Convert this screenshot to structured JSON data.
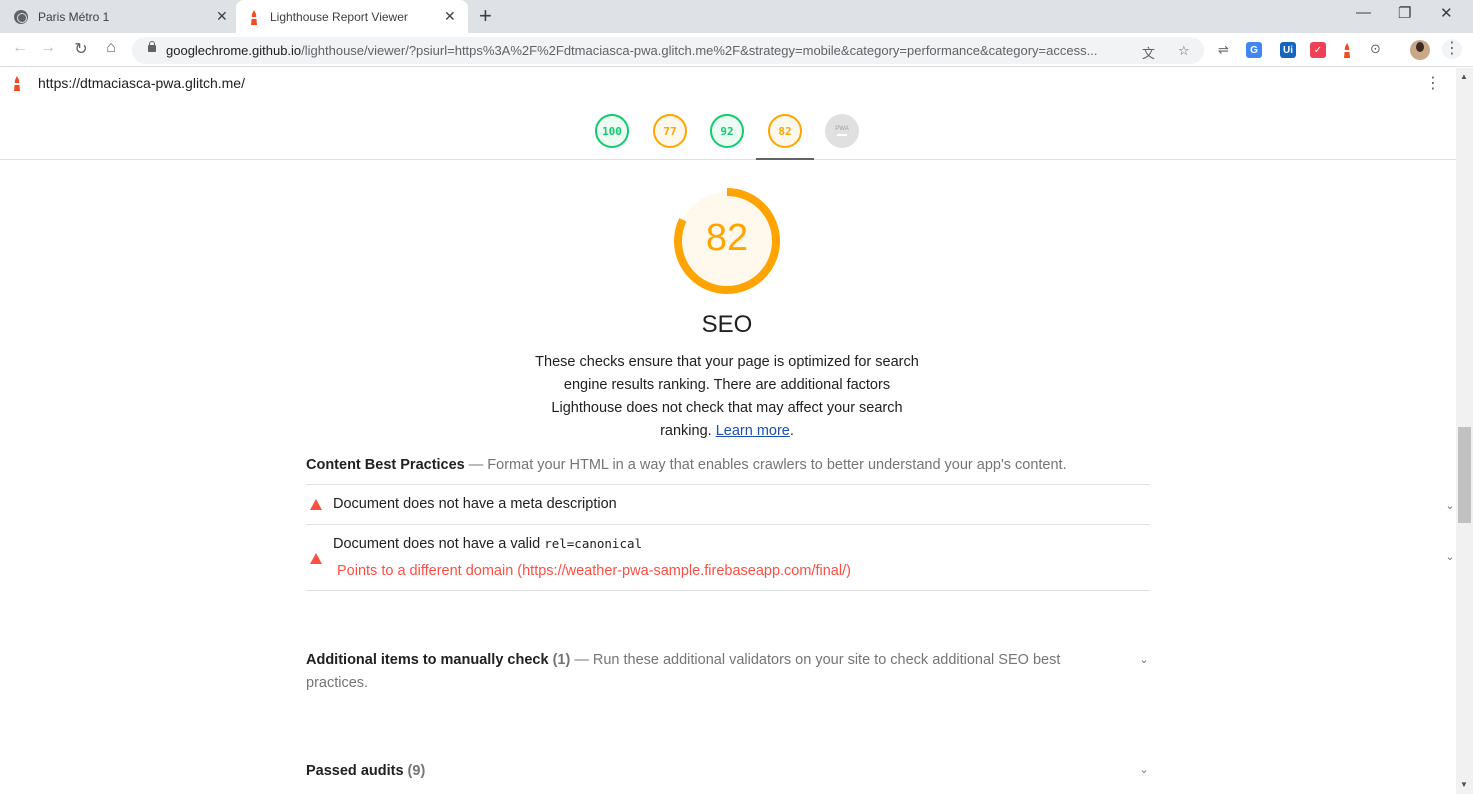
{
  "browser": {
    "tabs": [
      {
        "title": "Paris Métro 1",
        "active": false
      },
      {
        "title": "Lighthouse Report Viewer",
        "active": true
      }
    ],
    "new_tab": "+",
    "window_controls": {
      "minimize": "—",
      "restore": "❐",
      "close": "✕"
    },
    "url_host": "googlechrome.github.io",
    "url_rest": "/lighthouse/viewer/?psiurl=https%3A%2F%2Fdtmaciasca-pwa.glitch.me%2F&strategy=mobile&category=performance&category=access...",
    "extensions": [
      {
        "name": "translate-icon",
        "label": "G",
        "color": "#4285f4"
      },
      {
        "name": "ui-icon",
        "label": "Ui",
        "color": "#1565c0"
      },
      {
        "name": "pocket-icon",
        "label": "✓",
        "color": "#ef4056"
      },
      {
        "name": "lighthouse-ext-icon",
        "label": "",
        "color": "#f44b21"
      }
    ]
  },
  "report": {
    "site_url": "https://dtmaciasca-pwa.glitch.me/",
    "scores": [
      {
        "label": "100",
        "value": 100,
        "status": "green"
      },
      {
        "label": "77",
        "value": 77,
        "status": "orange"
      },
      {
        "label": "92",
        "value": 92,
        "status": "green"
      },
      {
        "label": "82",
        "value": 82,
        "status": "orange"
      },
      {
        "label": "PWA",
        "value": null,
        "status": "grey"
      }
    ],
    "category": {
      "score": "82",
      "score_value": 82,
      "title": "SEO",
      "description": "These checks ensure that your page is optimized for search engine results ranking. There are additional factors Lighthouse does not check that may affect your search ranking.",
      "learn_more": "Learn more",
      "end_period": "."
    },
    "groups": {
      "content": {
        "title": "Content Best Practices",
        "description": "— Format your HTML in a way that enables crawlers to better understand your app's content."
      },
      "manual": {
        "title": "Additional items to manually check",
        "count": "(1)",
        "description": "— Run these additional validators on your site to check additional SEO best practices."
      },
      "passed": {
        "title": "Passed audits",
        "count": "(9)"
      }
    },
    "audits": [
      {
        "title": "Document does not have a meta description"
      },
      {
        "title_prefix": "Document does not have a valid ",
        "title_code": "rel=canonical",
        "explanation": "Points to a different domain (https://weather-pwa-sample.firebaseapp.com/final/)"
      }
    ],
    "colors": {
      "pass": "#0cce6b",
      "average": "#ffa400",
      "fail": "#ff4e42"
    }
  }
}
